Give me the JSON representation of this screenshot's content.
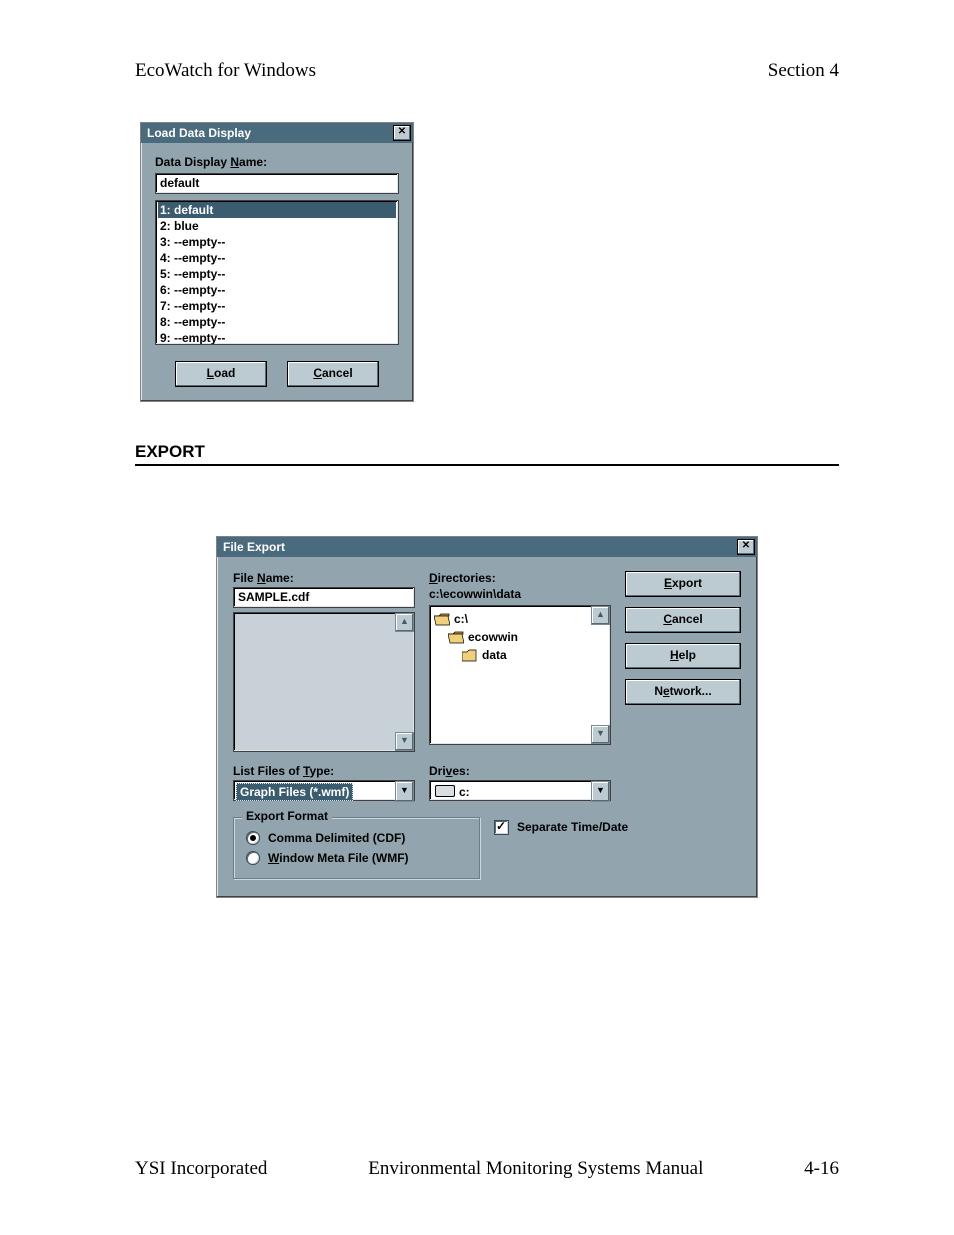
{
  "header": {
    "left": "EcoWatch for Windows",
    "right": "Section 4"
  },
  "load_dialog": {
    "title": "Load Data Display",
    "name_label": "Data Display Name:",
    "name_value": "default",
    "items": [
      "1:  default",
      "2:  blue",
      "3:  --empty--",
      "4:  --empty--",
      "5:  --empty--",
      "6:  --empty--",
      "7:  --empty--",
      "8:  --empty--",
      "9:  --empty--"
    ],
    "selected_index": 0,
    "load_btn": "Load",
    "cancel_btn": "Cancel"
  },
  "section_heading": "EXPORT",
  "export_dialog": {
    "title": "File Export",
    "file_name_label": "File Name:",
    "file_name_value": "SAMPLE.cdf",
    "directories_label": "Directories:",
    "dir_path": "c:\\ecowwin\\data",
    "dir_tree": [
      {
        "name": "c:\\",
        "level": 0,
        "open": true
      },
      {
        "name": "ecowwin",
        "level": 1,
        "open": true
      },
      {
        "name": "data",
        "level": 2,
        "open": false
      }
    ],
    "buttons": {
      "export": "Export",
      "cancel": "Cancel",
      "help": "Help",
      "network": "Network..."
    },
    "list_files_label": "List Files of Type:",
    "list_files_value": "Graph Files (*.wmf)",
    "drives_label": "Drives:",
    "drives_value": "c:",
    "group_legend": "Export Format",
    "radio_cdf": "Comma Delimited (CDF)",
    "radio_wmf": "Window Meta File (WMF)",
    "radio_selected": "cdf",
    "separate_label": "Separate Time/Date",
    "separate_checked": true
  },
  "footer": {
    "left": "YSI Incorporated",
    "center": "Environmental Monitoring Systems Manual",
    "right": "4-16"
  }
}
